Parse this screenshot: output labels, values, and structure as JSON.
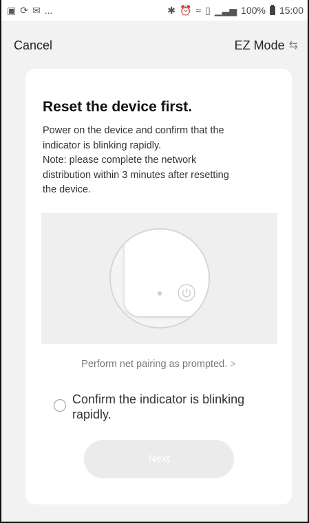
{
  "status_bar": {
    "left_text": "...",
    "battery": "100%",
    "time": "15:00"
  },
  "header": {
    "cancel_label": "Cancel",
    "mode_label": "EZ Mode"
  },
  "card": {
    "title": "Reset the device first.",
    "description_lines": [
      "Power on the device and confirm that the",
      "indicator is blinking rapidly.",
      "Note: please complete the network",
      "distribution within 3 minutes after resetting",
      "the device."
    ],
    "prompt_link": "Perform net pairing as prompted.",
    "prompt_arrow": ">",
    "confirm_label": "Confirm the indicator is blinking rapidly.",
    "confirm_checked": false,
    "next_label": "Next"
  },
  "icons": {
    "gallery": "gallery-icon",
    "sync": "sync-icon",
    "mail": "mail-icon",
    "bluetooth": "bluetooth-icon",
    "alarm": "alarm-icon",
    "wifi": "wifi-icon",
    "sim": "sim-icon",
    "signal": "signal-icon",
    "battery": "battery-icon",
    "swap": "swap-icon",
    "power": "power-icon"
  }
}
